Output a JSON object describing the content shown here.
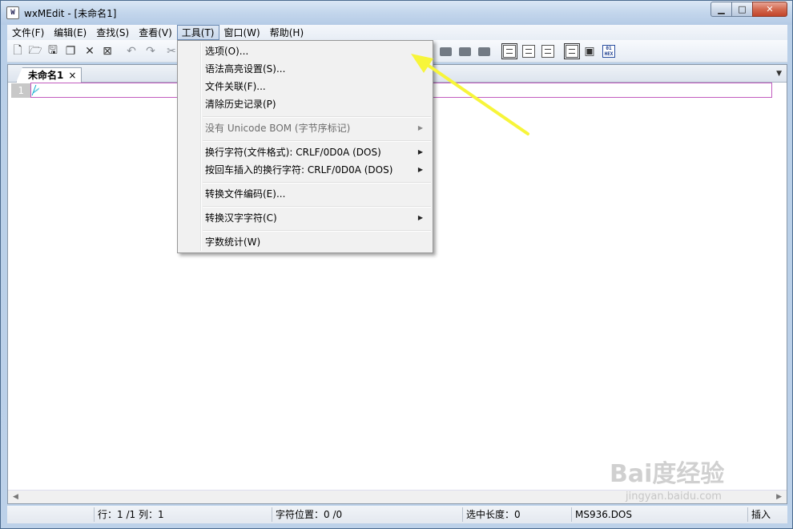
{
  "window": {
    "title": "wxMEdit - [未命名1]",
    "app_icon": "W",
    "buttons": {
      "minimize": "▁",
      "maximize": "□",
      "close": "✕"
    }
  },
  "menubar": {
    "items": [
      {
        "label": "文件(F)"
      },
      {
        "label": "编辑(E)"
      },
      {
        "label": "查找(S)"
      },
      {
        "label": "查看(V)"
      },
      {
        "label": "工具(T)"
      },
      {
        "label": "窗口(W)"
      },
      {
        "label": "帮助(H)"
      }
    ],
    "active": "工具(T)"
  },
  "toolbar": {
    "icons": [
      "new-file-icon",
      "open-file-icon",
      "save-icon",
      "save-all-icon",
      "close-icon",
      "close-all-icon",
      "undo-icon",
      "redo-icon",
      "cut-icon",
      "comment-icon",
      "uncomment-icon",
      "wrap-icon",
      "unwrap-icon",
      "text-mode-icon",
      "column-mode-icon",
      "hex-mode-icon",
      "edit-mode-icon",
      "bookmark-icon",
      "hex-view-icon"
    ],
    "hex_label": "01 HEX"
  },
  "editor": {
    "tab_label": "未命名1",
    "tab_close": "×",
    "tab_dropdown": "▼",
    "line_number": "1"
  },
  "tools_menu": {
    "items": [
      {
        "label": "选项(O)...",
        "disabled": false,
        "submenu": false
      },
      {
        "label": "语法高亮设置(S)...",
        "disabled": false,
        "submenu": false
      },
      {
        "label": "文件关联(F)...",
        "disabled": false,
        "submenu": false
      },
      {
        "label": "清除历史记录(P)",
        "disabled": false,
        "submenu": false
      },
      {
        "label": "没有 Unicode BOM (字节序标记)",
        "disabled": true,
        "submenu": true
      },
      {
        "label": "换行字符(文件格式): CRLF/0D0A (DOS)",
        "disabled": false,
        "submenu": true
      },
      {
        "label": "按回车插入的换行字符: CRLF/0D0A (DOS)",
        "disabled": false,
        "submenu": true
      },
      {
        "label": "转换文件编码(E)...",
        "disabled": false,
        "submenu": false
      },
      {
        "label": "转换汉字字符(C)",
        "disabled": false,
        "submenu": true
      },
      {
        "label": "字数统计(W)",
        "disabled": false,
        "submenu": false
      }
    ],
    "submenu_arrow": "▶"
  },
  "statusbar": {
    "line_col": "行：1 /1 列：1",
    "char_pos": "字符位置：0 /0",
    "selection": "选中长度：0",
    "encoding": "MS936.DOS",
    "mode": "插入"
  },
  "watermark": {
    "main": "Bai度经验",
    "sub": "jingyan.baidu.com"
  },
  "colors": {
    "annotation_arrow": "#f7f53a",
    "current_line_border": "#c25cbf",
    "gutter_bg": "#c8c8c8"
  }
}
